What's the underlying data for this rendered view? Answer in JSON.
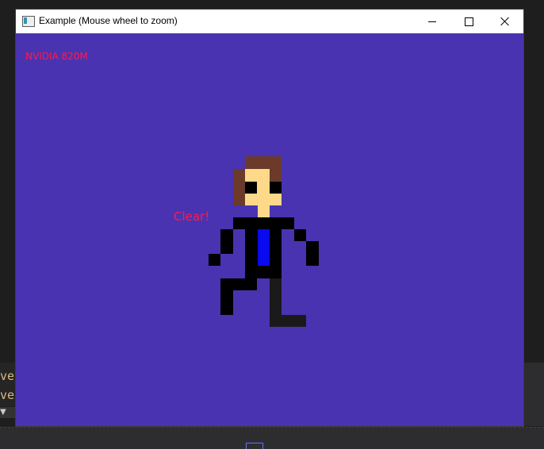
{
  "background": {
    "ide_line_1": "ve",
    "ide_line_2": "ve",
    "arrow_glyph": "▼"
  },
  "window": {
    "title": "Example (Mouse wheel to zoom)",
    "icon": "app-window-icon",
    "controls": {
      "minimize": "minimize-icon",
      "maximize": "maximize-icon",
      "close": "close-icon"
    }
  },
  "canvas": {
    "background_color": "#4a33b0",
    "gpu_label": "NVIDIA 820M",
    "status_label": "Clear!",
    "label_color": "#ff1a4a"
  },
  "sprite": {
    "name": "pixel-character",
    "colors": {
      "hair": "#6b3a2a",
      "skin": "#ffd98a",
      "glasses": "#000000",
      "jacket": "#000000",
      "tie": "#0a0aee",
      "trouser": "#1a1a1a"
    }
  }
}
